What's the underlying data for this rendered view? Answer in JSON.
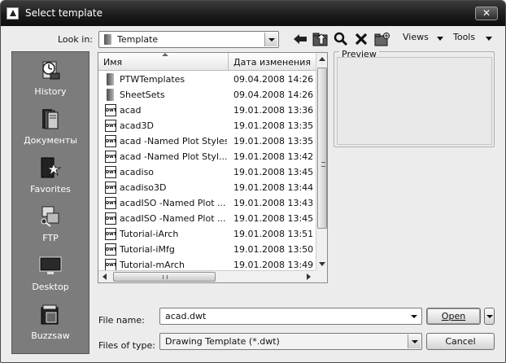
{
  "window": {
    "title": "Select template",
    "close_glyph": "✕"
  },
  "toolbar": {
    "look_in_label": "Look in:",
    "look_in_value": "Template",
    "views_label": "Views",
    "tools_label": "Tools",
    "icons": [
      "back-arrow-icon",
      "up-folder-icon",
      "search-web-icon",
      "delete-icon",
      "create-folder-icon"
    ]
  },
  "places": [
    {
      "label": "History",
      "icon": "history-icon"
    },
    {
      "label": "Документы",
      "icon": "documents-icon"
    },
    {
      "label": "Favorites",
      "icon": "favorites-icon"
    },
    {
      "label": "FTP",
      "icon": "ftp-icon"
    },
    {
      "label": "Desktop",
      "icon": "desktop-icon"
    },
    {
      "label": "Buzzsaw",
      "icon": "buzzsaw-icon"
    }
  ],
  "file_list": {
    "columns": {
      "name": "Имя",
      "date": "Дата изменения"
    },
    "rows": [
      {
        "name": "PTWTemplates",
        "date": "09.04.2008 14:26",
        "type": "folder"
      },
      {
        "name": "SheetSets",
        "date": "09.04.2008 14:26",
        "type": "folder"
      },
      {
        "name": "acad",
        "date": "19.01.2008 13:36",
        "type": "dwt"
      },
      {
        "name": "acad3D",
        "date": "19.01.2008 13:35",
        "type": "dwt"
      },
      {
        "name": "acad -Named Plot Styles",
        "date": "19.01.2008 13:35",
        "type": "dwt"
      },
      {
        "name": "acad -Named Plot Styl...",
        "date": "19.01.2008 13:42",
        "type": "dwt"
      },
      {
        "name": "acadiso",
        "date": "19.01.2008 13:45",
        "type": "dwt"
      },
      {
        "name": "acadiso3D",
        "date": "19.01.2008 13:44",
        "type": "dwt"
      },
      {
        "name": "acadISO -Named Plot ...",
        "date": "19.01.2008 13:43",
        "type": "dwt"
      },
      {
        "name": "acadISO -Named Plot ...",
        "date": "19.01.2008 13:45",
        "type": "dwt"
      },
      {
        "name": "Tutorial-iArch",
        "date": "19.01.2008 13:51",
        "type": "dwt"
      },
      {
        "name": "Tutorial-iMfg",
        "date": "19.01.2008 13:50",
        "type": "dwt"
      },
      {
        "name": "Tutorial-mArch",
        "date": "19.01.2008 13:49",
        "type": "dwt"
      }
    ]
  },
  "preview": {
    "label": "Preview"
  },
  "form": {
    "file_name_label": "File name:",
    "file_name_value": "acad.dwt",
    "file_type_label": "Files of type:",
    "file_type_value": "Drawing Template (*.dwt)"
  },
  "buttons": {
    "open": "Open",
    "cancel": "Cancel"
  }
}
